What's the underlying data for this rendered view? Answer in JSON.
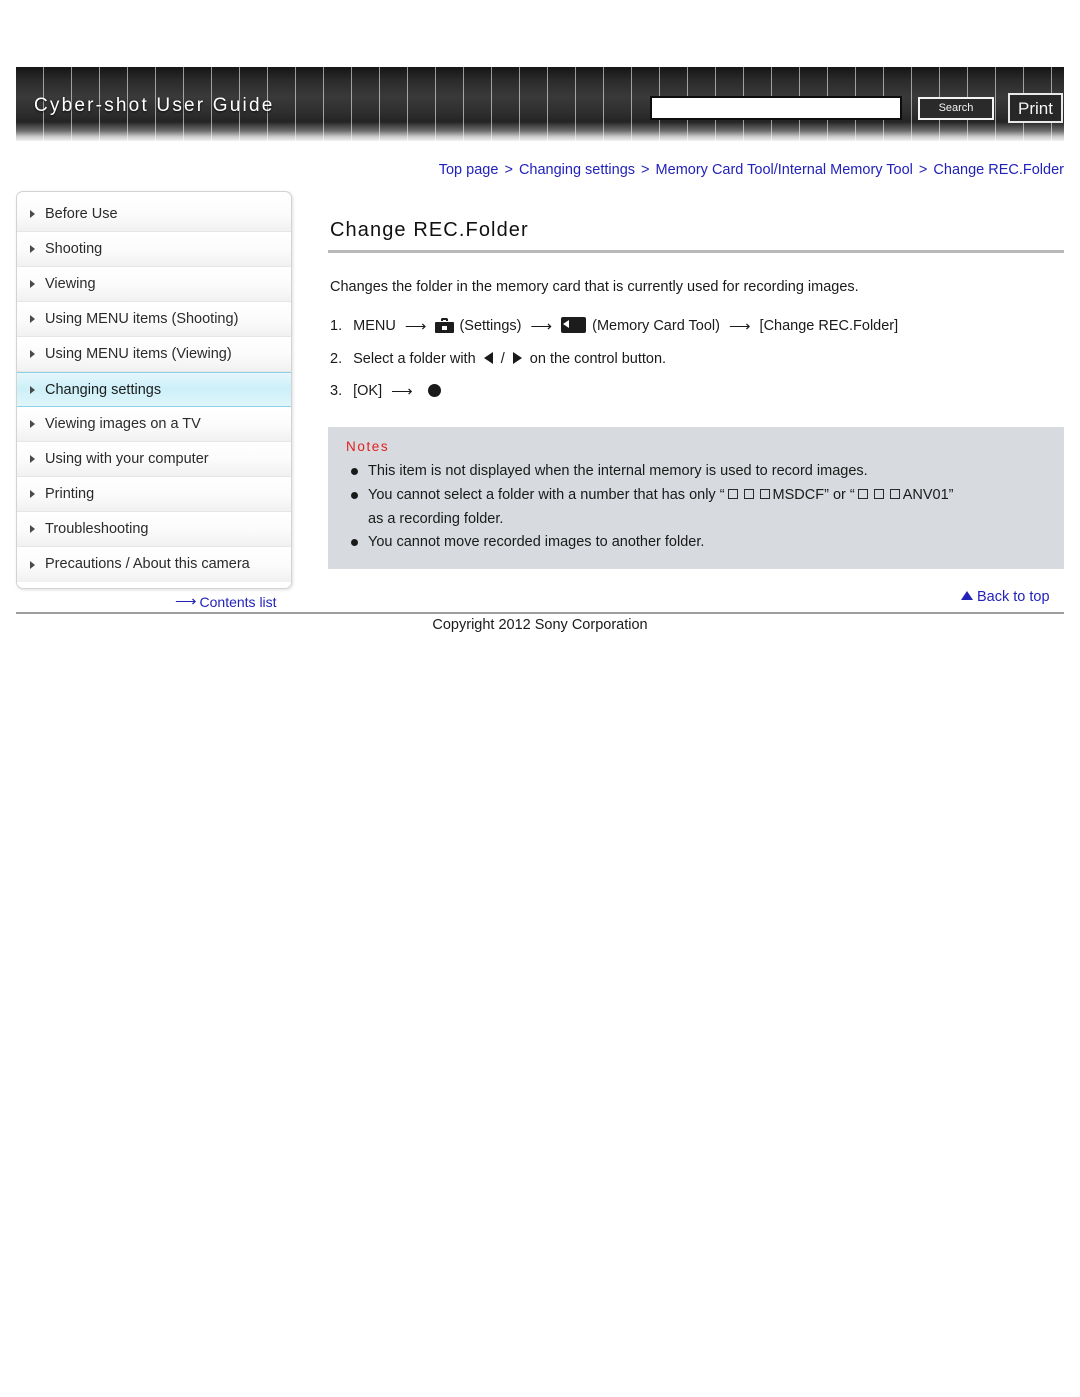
{
  "header": {
    "site_title": "Cyber-shot User Guide",
    "search": {
      "value": "",
      "placeholder": "",
      "button_label": "Search"
    },
    "print_label": "Print"
  },
  "breadcrumb": {
    "separator": ">",
    "items": [
      "Top page",
      "Changing settings",
      "Memory Card Tool/Internal Memory Tool",
      "Change REC.Folder"
    ]
  },
  "sidebar": {
    "items": [
      {
        "label": "Before Use",
        "active": false
      },
      {
        "label": "Shooting",
        "active": false
      },
      {
        "label": "Viewing",
        "active": false
      },
      {
        "label": "Using MENU items (Shooting)",
        "active": false
      },
      {
        "label": "Using MENU items (Viewing)",
        "active": false
      },
      {
        "label": "Changing settings",
        "active": true
      },
      {
        "label": "Viewing images on a TV",
        "active": false
      },
      {
        "label": "Using with your computer",
        "active": false
      },
      {
        "label": "Printing",
        "active": false
      },
      {
        "label": "Troubleshooting",
        "active": false
      },
      {
        "label": "Precautions / About this camera",
        "active": false
      }
    ]
  },
  "main": {
    "title": "Change REC.Folder",
    "intro": "Changes the folder in the memory card that is currently used for recording images.",
    "steps": {
      "step1": {
        "num": "1.",
        "menu_label": "MENU",
        "settings_label": "(Settings)",
        "memcard_label": "(Memory Card Tool)",
        "target_label": "[Change REC.Folder]"
      },
      "step2": {
        "num": "2.",
        "text_before": "Select a folder with",
        "slash": "/",
        "text_after": "on the control button."
      },
      "step3": {
        "num": "3.",
        "ok_label": "[OK]"
      }
    },
    "notes": {
      "title": "Notes",
      "items": [
        "This item is not displayed when the internal memory is used to record images.",
        "You cannot move recorded images to another folder."
      ],
      "item2": {
        "part1": "You cannot select a folder with a number that has only “",
        "part2": "MSDCF” or “",
        "part3": "ANV01”",
        "continuation": "as a recording folder."
      }
    }
  },
  "footer": {
    "contents_list": "Contents list",
    "back_to_top": "Back to top",
    "copyright": "Copyright 2012 Sony Corporation"
  },
  "colors": {
    "link": "#2222bb",
    "notes_title": "#e02020",
    "notes_bg": "#d7dade",
    "active_nav": "#cdeff8"
  }
}
